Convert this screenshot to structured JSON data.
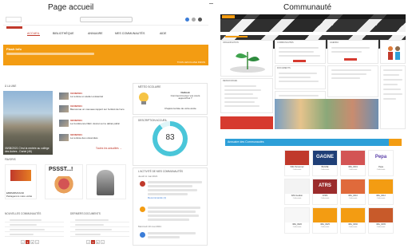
{
  "headings": {
    "left": "Page accueil",
    "right": "Communauté"
  },
  "left": {
    "nav": [
      "ACCUEIL",
      "BIBLIOTHÈQUE",
      "ANNUAIRE",
      "MES COMMUNAUTÉS",
      "AIDE"
    ],
    "flash": {
      "title": "Flash Info",
      "link": "TOUS LES FLASH INFOS"
    },
    "sections": {
      "news": "À LA UNE",
      "weather": "MÉTÉO SCOLAIRE",
      "stats": "DESCRIPTION ACCUEIL",
      "activity": "L'ACTIVITÉ DE MES COMMUNAUTÉS",
      "favorites": "FAVORIS",
      "recent": "DERNIERS DOCUMENTS",
      "communities": "NOUVELLES COMMUNAUTÉS"
    },
    "news_caption": "05/08/2021 C'est la rentrée au collège des Aubes - Dorlat (46)",
    "news_items": [
      {
        "date": "01/08/2021",
        "text": "La rentrée un atelier existentiel"
      },
      {
        "date": "01/08/2021",
        "text": "Bienvenue un nouveau rapport sur l'enfant de l'eco"
      },
      {
        "date": "02/08/2021",
        "text": "La Conférence DEC: décret sur le débat public"
      },
      {
        "date": "02/08/2021",
        "text": "La rentrée des universités"
      }
    ],
    "news_more": "Toutes les actualités →",
    "weather": {
      "title": "Outlook",
      "text": "Comment trouver vos cours aujourd'hui ?",
      "question": "D'après la liste de votre école"
    },
    "stat_value": "83",
    "cards": [
      {
        "label": "EBRMMMXAND Partagerons notre vérité"
      },
      {
        "label": "PSSST...!"
      },
      {
        "label": ""
      }
    ],
    "pages": [
      "<",
      "1",
      "2",
      ">"
    ],
    "activity_date": "Jeudi 11 mai 2021",
    "activity_date2": "Mercredi 10 mai 2021",
    "activity_note": "Recommandé (1)"
  },
  "right": {
    "annuaire": "Annuaire des Communautés",
    "communities": [
      {
        "name": "IMG Personnel",
        "sub": "Collectivité",
        "color": "#c0392b",
        "text": ""
      },
      {
        "name": "BAGNE",
        "sub": "Collectivité",
        "color": "#1f3f77",
        "text": "GAGNE"
      },
      {
        "name": "IMG_0001",
        "sub": "Collectivité",
        "color": "#d35454",
        "text": ""
      },
      {
        "name": "Pepa",
        "sub": "Collectivité",
        "color": "#ffffff",
        "text": "Pepa"
      },
      {
        "name": "IMG Gestion",
        "sub": "Collectivité",
        "color": "#f3f3f3",
        "text": ""
      },
      {
        "name": "ATRS",
        "sub": "Collectivité",
        "color": "#9b2c2c",
        "text": "ATRS"
      },
      {
        "name": "IMG_0010",
        "sub": "Collectivité",
        "color": "#e06a3b",
        "text": ""
      },
      {
        "name": "IMG_0012",
        "sub": "Collectivité",
        "color": "#f39c12",
        "text": ""
      },
      {
        "name": "IMG_0020",
        "sub": "Collectivité",
        "color": "#f7f7f7",
        "text": ""
      },
      {
        "name": "IMG_0025",
        "sub": "Collectivité",
        "color": "#f39c12",
        "text": ""
      },
      {
        "name": "IMG_0030",
        "sub": "Collectivité",
        "color": "#f39c12",
        "text": ""
      },
      {
        "name": "IMG_0035",
        "sub": "Collectivité",
        "color": "#c85a2a",
        "text": ""
      }
    ],
    "widgets": [
      "ORGANISATION",
      "RESSOURCES",
      "COMMUNAUTÉS",
      "DOCUMENTS",
      "AGENDA"
    ]
  },
  "colors": {
    "accent": "#c0392b",
    "orange": "#f39c12",
    "teal": "#4ac6d9",
    "blue": "#2d9fd8"
  }
}
